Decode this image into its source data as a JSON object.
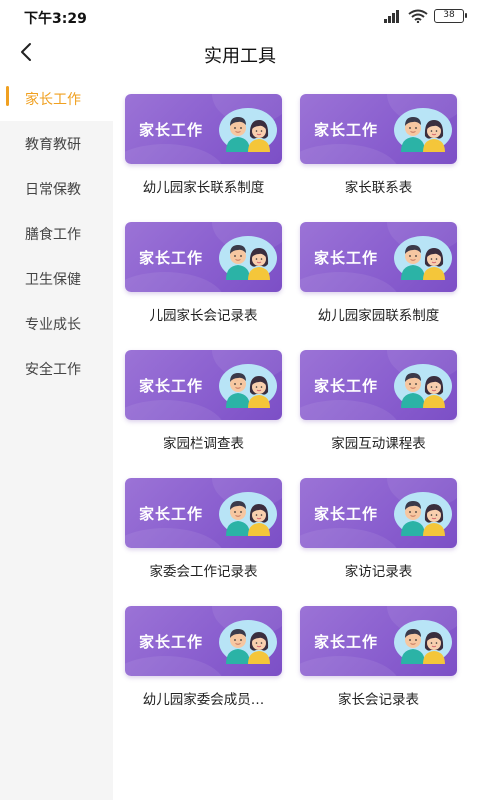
{
  "status_bar": {
    "time": "下午3:29",
    "battery": "38"
  },
  "header": {
    "title": "实用工具"
  },
  "sidebar": {
    "items": [
      {
        "label": "家长工作",
        "active": true
      },
      {
        "label": "教育教研",
        "active": false
      },
      {
        "label": "日常保教",
        "active": false
      },
      {
        "label": "膳食工作",
        "active": false
      },
      {
        "label": "卫生保健",
        "active": false
      },
      {
        "label": "专业成长",
        "active": false
      },
      {
        "label": "安全工作",
        "active": false
      }
    ]
  },
  "colors": {
    "accent": "#f0a020",
    "banner_purple": "#8a5fcf",
    "sidebar_bg": "#f5f5f5"
  },
  "tools": [
    {
      "banner": "家长工作",
      "label": "幼儿园家长联系制度"
    },
    {
      "banner": "家长工作",
      "label": "家长联系表"
    },
    {
      "banner": "家长工作",
      "label": "儿园家长会记录表"
    },
    {
      "banner": "家长工作",
      "label": "幼儿园家园联系制度"
    },
    {
      "banner": "家长工作",
      "label": "家园栏调查表"
    },
    {
      "banner": "家长工作",
      "label": "家园互动课程表"
    },
    {
      "banner": "家长工作",
      "label": "家委会工作记录表"
    },
    {
      "banner": "家长工作",
      "label": "家访记录表"
    },
    {
      "banner": "家长工作",
      "label": "幼儿园家委会成员…"
    },
    {
      "banner": "家长工作",
      "label": "家长会记录表"
    }
  ]
}
